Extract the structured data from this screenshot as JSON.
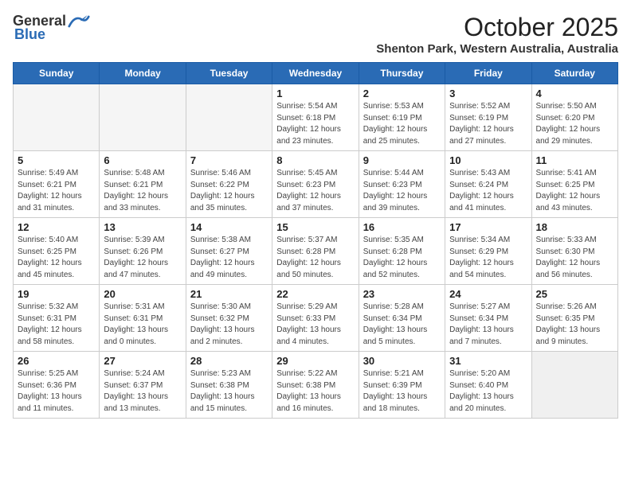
{
  "header": {
    "logo_general": "General",
    "logo_blue": "Blue",
    "month": "October 2025",
    "location": "Shenton Park, Western Australia, Australia"
  },
  "weekdays": [
    "Sunday",
    "Monday",
    "Tuesday",
    "Wednesday",
    "Thursday",
    "Friday",
    "Saturday"
  ],
  "weeks": [
    [
      {
        "day": "",
        "info": ""
      },
      {
        "day": "",
        "info": ""
      },
      {
        "day": "",
        "info": ""
      },
      {
        "day": "1",
        "info": "Sunrise: 5:54 AM\nSunset: 6:18 PM\nDaylight: 12 hours\nand 23 minutes."
      },
      {
        "day": "2",
        "info": "Sunrise: 5:53 AM\nSunset: 6:19 PM\nDaylight: 12 hours\nand 25 minutes."
      },
      {
        "day": "3",
        "info": "Sunrise: 5:52 AM\nSunset: 6:19 PM\nDaylight: 12 hours\nand 27 minutes."
      },
      {
        "day": "4",
        "info": "Sunrise: 5:50 AM\nSunset: 6:20 PM\nDaylight: 12 hours\nand 29 minutes."
      }
    ],
    [
      {
        "day": "5",
        "info": "Sunrise: 5:49 AM\nSunset: 6:21 PM\nDaylight: 12 hours\nand 31 minutes."
      },
      {
        "day": "6",
        "info": "Sunrise: 5:48 AM\nSunset: 6:21 PM\nDaylight: 12 hours\nand 33 minutes."
      },
      {
        "day": "7",
        "info": "Sunrise: 5:46 AM\nSunset: 6:22 PM\nDaylight: 12 hours\nand 35 minutes."
      },
      {
        "day": "8",
        "info": "Sunrise: 5:45 AM\nSunset: 6:23 PM\nDaylight: 12 hours\nand 37 minutes."
      },
      {
        "day": "9",
        "info": "Sunrise: 5:44 AM\nSunset: 6:23 PM\nDaylight: 12 hours\nand 39 minutes."
      },
      {
        "day": "10",
        "info": "Sunrise: 5:43 AM\nSunset: 6:24 PM\nDaylight: 12 hours\nand 41 minutes."
      },
      {
        "day": "11",
        "info": "Sunrise: 5:41 AM\nSunset: 6:25 PM\nDaylight: 12 hours\nand 43 minutes."
      }
    ],
    [
      {
        "day": "12",
        "info": "Sunrise: 5:40 AM\nSunset: 6:25 PM\nDaylight: 12 hours\nand 45 minutes."
      },
      {
        "day": "13",
        "info": "Sunrise: 5:39 AM\nSunset: 6:26 PM\nDaylight: 12 hours\nand 47 minutes."
      },
      {
        "day": "14",
        "info": "Sunrise: 5:38 AM\nSunset: 6:27 PM\nDaylight: 12 hours\nand 49 minutes."
      },
      {
        "day": "15",
        "info": "Sunrise: 5:37 AM\nSunset: 6:28 PM\nDaylight: 12 hours\nand 50 minutes."
      },
      {
        "day": "16",
        "info": "Sunrise: 5:35 AM\nSunset: 6:28 PM\nDaylight: 12 hours\nand 52 minutes."
      },
      {
        "day": "17",
        "info": "Sunrise: 5:34 AM\nSunset: 6:29 PM\nDaylight: 12 hours\nand 54 minutes."
      },
      {
        "day": "18",
        "info": "Sunrise: 5:33 AM\nSunset: 6:30 PM\nDaylight: 12 hours\nand 56 minutes."
      }
    ],
    [
      {
        "day": "19",
        "info": "Sunrise: 5:32 AM\nSunset: 6:31 PM\nDaylight: 12 hours\nand 58 minutes."
      },
      {
        "day": "20",
        "info": "Sunrise: 5:31 AM\nSunset: 6:31 PM\nDaylight: 13 hours\nand 0 minutes."
      },
      {
        "day": "21",
        "info": "Sunrise: 5:30 AM\nSunset: 6:32 PM\nDaylight: 13 hours\nand 2 minutes."
      },
      {
        "day": "22",
        "info": "Sunrise: 5:29 AM\nSunset: 6:33 PM\nDaylight: 13 hours\nand 4 minutes."
      },
      {
        "day": "23",
        "info": "Sunrise: 5:28 AM\nSunset: 6:34 PM\nDaylight: 13 hours\nand 5 minutes."
      },
      {
        "day": "24",
        "info": "Sunrise: 5:27 AM\nSunset: 6:34 PM\nDaylight: 13 hours\nand 7 minutes."
      },
      {
        "day": "25",
        "info": "Sunrise: 5:26 AM\nSunset: 6:35 PM\nDaylight: 13 hours\nand 9 minutes."
      }
    ],
    [
      {
        "day": "26",
        "info": "Sunrise: 5:25 AM\nSunset: 6:36 PM\nDaylight: 13 hours\nand 11 minutes."
      },
      {
        "day": "27",
        "info": "Sunrise: 5:24 AM\nSunset: 6:37 PM\nDaylight: 13 hours\nand 13 minutes."
      },
      {
        "day": "28",
        "info": "Sunrise: 5:23 AM\nSunset: 6:38 PM\nDaylight: 13 hours\nand 15 minutes."
      },
      {
        "day": "29",
        "info": "Sunrise: 5:22 AM\nSunset: 6:38 PM\nDaylight: 13 hours\nand 16 minutes."
      },
      {
        "day": "30",
        "info": "Sunrise: 5:21 AM\nSunset: 6:39 PM\nDaylight: 13 hours\nand 18 minutes."
      },
      {
        "day": "31",
        "info": "Sunrise: 5:20 AM\nSunset: 6:40 PM\nDaylight: 13 hours\nand 20 minutes."
      },
      {
        "day": "",
        "info": ""
      }
    ]
  ]
}
